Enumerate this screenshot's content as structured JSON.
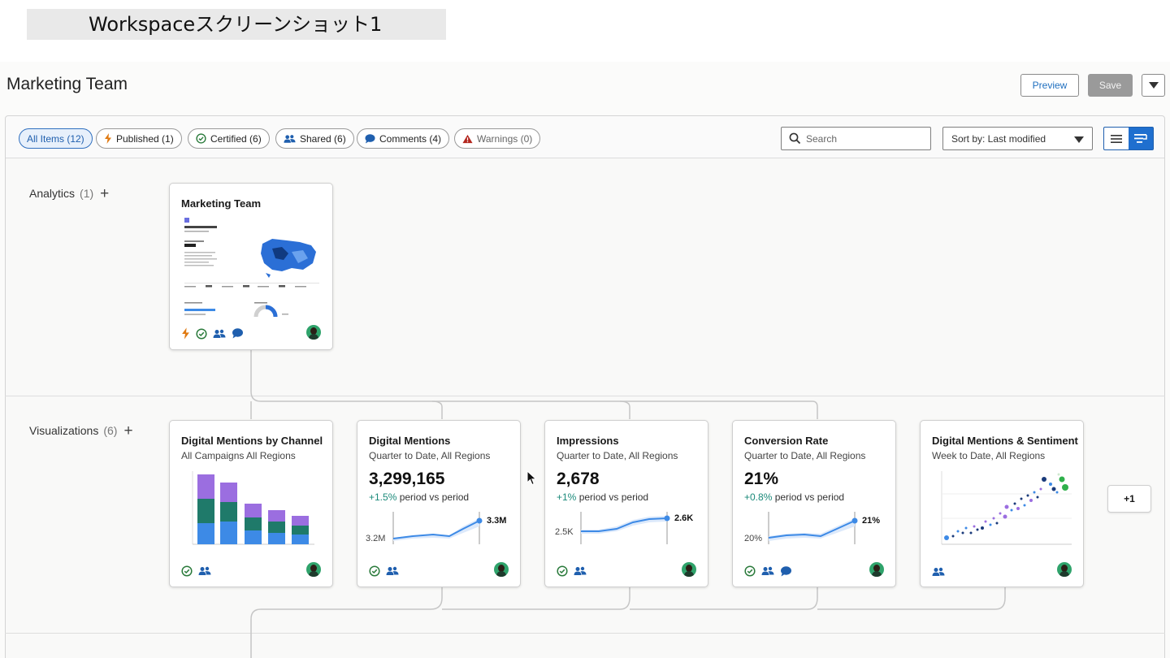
{
  "caption": "Workspaceスクリーンショット1",
  "header": {
    "title": "Marketing Team",
    "preview_label": "Preview",
    "save_label": "Save"
  },
  "filters": [
    {
      "label": "All Items (12)",
      "icon": "none"
    },
    {
      "label": "Published (1)",
      "icon": "lightning-icon"
    },
    {
      "label": "Certified (6)",
      "icon": "check-circle-icon"
    },
    {
      "label": "Shared (6)",
      "icon": "users-icon"
    },
    {
      "label": "Comments (4)",
      "icon": "comment-icon"
    },
    {
      "label": "Warnings (0)",
      "icon": "warning-icon"
    }
  ],
  "search": {
    "placeholder": "Search"
  },
  "sort": {
    "value": "Sort by: Last modified"
  },
  "sections": {
    "analytics": {
      "label": "Analytics",
      "count": "(1)"
    },
    "visualizations": {
      "label": "Visualizations",
      "count": "(6)"
    }
  },
  "analytics_card": {
    "title": "Marketing Team"
  },
  "viz_cards": [
    {
      "title": "Digital Mentions by Channel",
      "subtitle": "All Campaigns  All Regions"
    },
    {
      "title": "Digital Mentions",
      "subtitle": "Quarter to Date,  All Regions",
      "value": "3,299,165",
      "delta": "+1.5%",
      "delta_label": "period vs period",
      "start_label": "3.2M",
      "end_label": "3.3M"
    },
    {
      "title": "Impressions",
      "subtitle": "Quarter to Date,  All Regions",
      "value": "2,678",
      "delta": "+1%",
      "delta_label": "period vs period",
      "start_label": "2.5K",
      "end_label": "2.6K"
    },
    {
      "title": "Conversion Rate",
      "subtitle": "Quarter to Date,  All Regions",
      "value": "21%",
      "delta": "+0.8%",
      "delta_label": "period vs period",
      "start_label": "20%",
      "end_label": "21%"
    },
    {
      "title": "Digital Mentions & Sentiment",
      "subtitle": "Week to Date,  All Regions"
    }
  ],
  "more_label": "+1",
  "colors": {
    "accent": "#1f6fcf",
    "published": "#e07a12",
    "certified": "#2a7a3b",
    "shared": "#1f5fae",
    "warning": "#b3261e",
    "positive": "#1b8a7a",
    "bar_purple": "#9b6ee0",
    "bar_teal": "#1f7a6a",
    "bar_blue": "#3d8ae6"
  }
}
